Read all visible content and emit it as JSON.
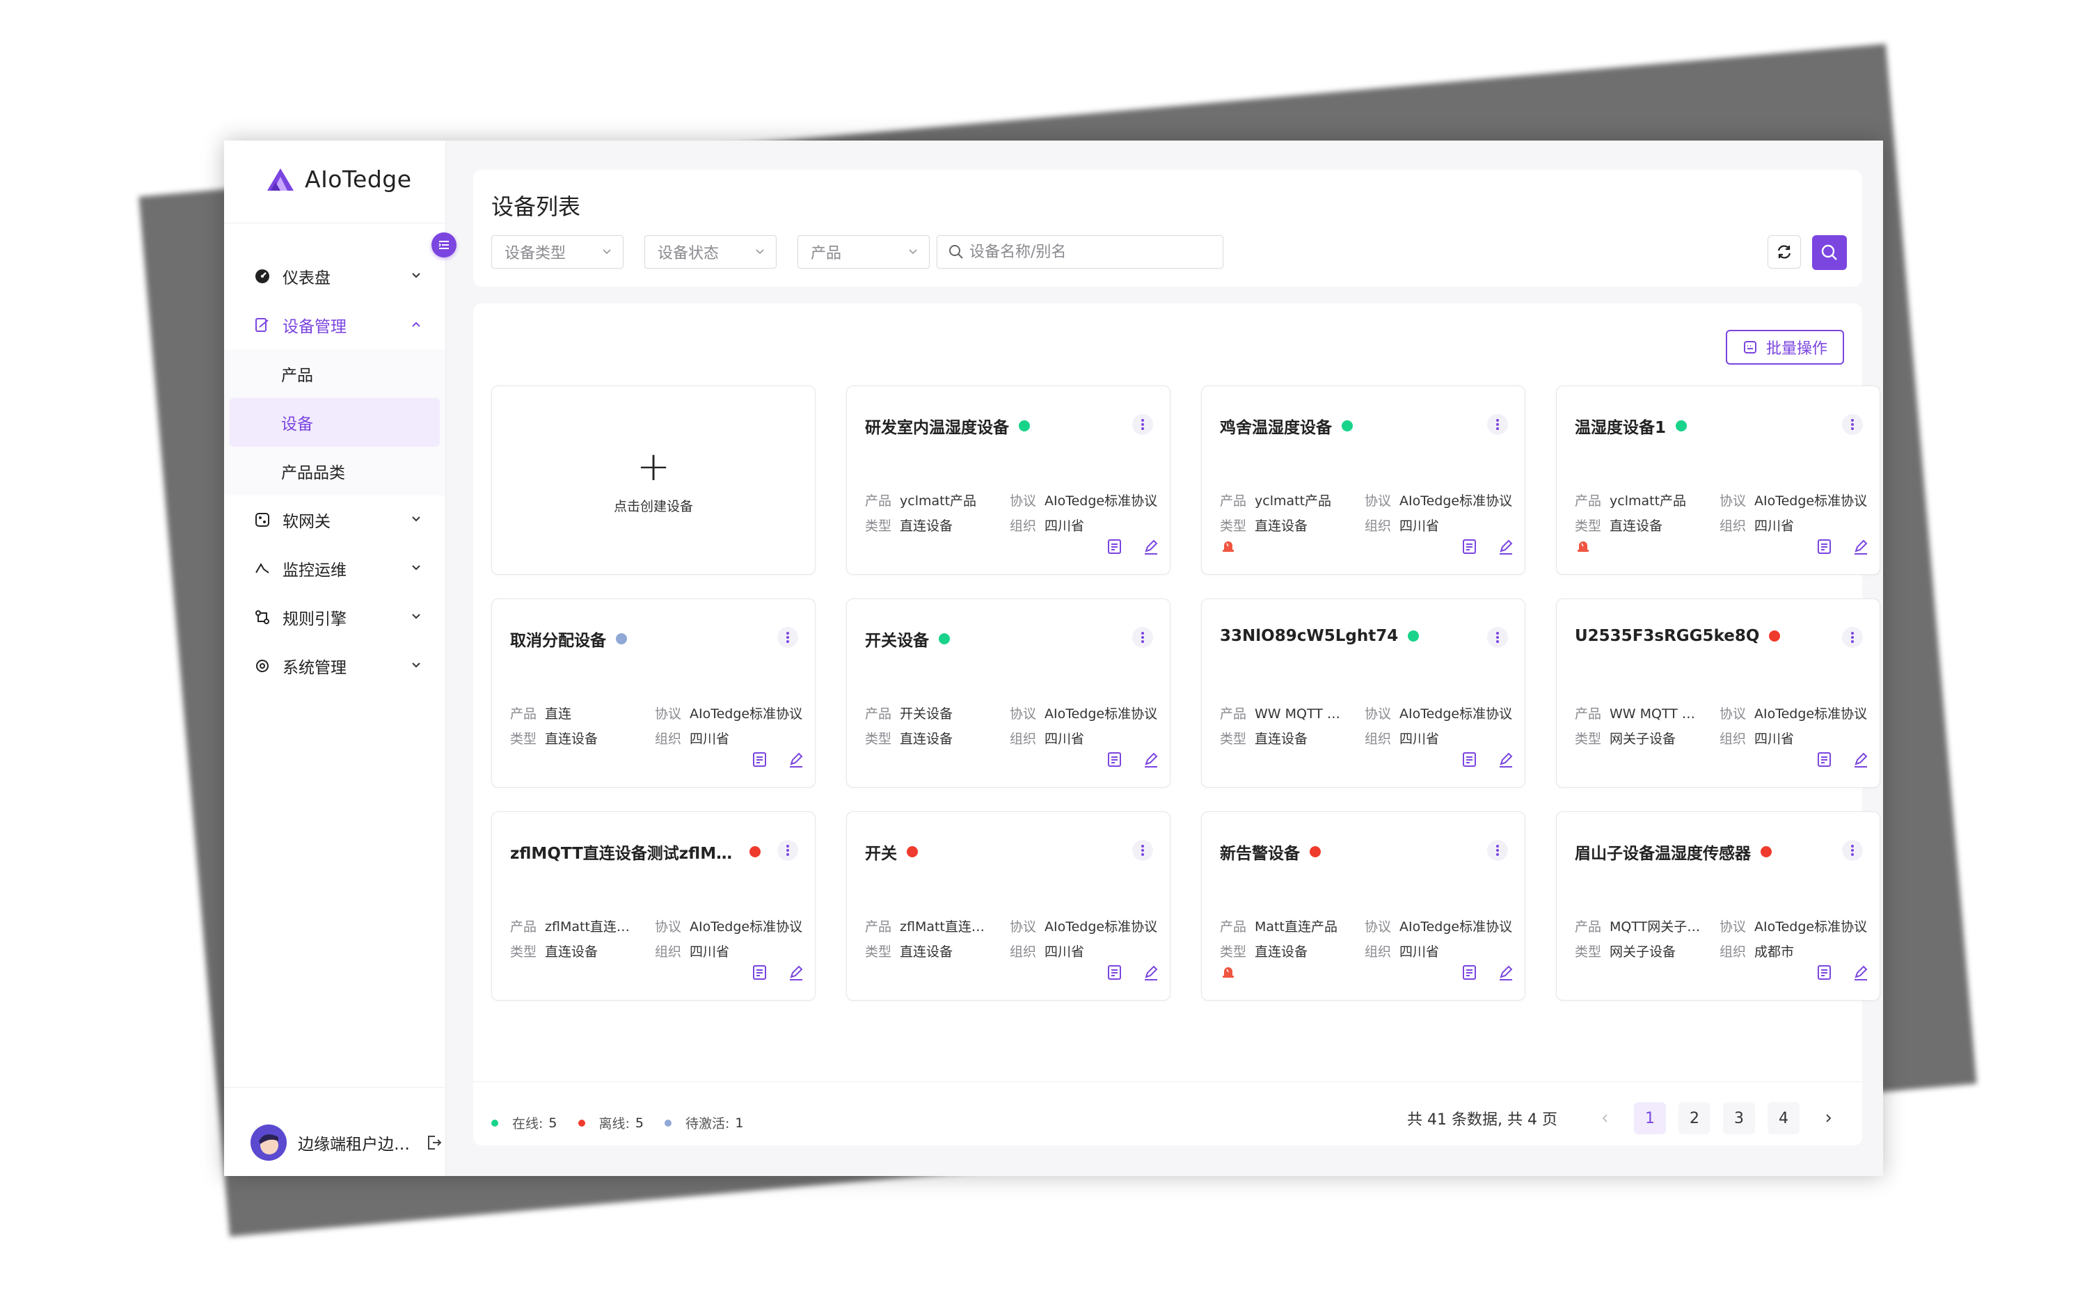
{
  "app": {
    "logo_text": "AIoTedge"
  },
  "sidebar": {
    "items": [
      {
        "label": "仪表盘",
        "icon": "dashboard-icon"
      },
      {
        "label": "设备管理",
        "icon": "device-manage-icon",
        "active": true,
        "children": [
          {
            "label": "产品"
          },
          {
            "label": "设备",
            "selected": true
          },
          {
            "label": "产品品类"
          }
        ]
      },
      {
        "label": "软网关",
        "icon": "gateway-icon"
      },
      {
        "label": "监控运维",
        "icon": "monitor-icon"
      },
      {
        "label": "规则引擎",
        "icon": "rule-icon"
      },
      {
        "label": "系统管理",
        "icon": "settings-icon"
      }
    ],
    "user": {
      "name": "边缘端租户边…"
    }
  },
  "header": {
    "title": "设备列表",
    "filters": {
      "device_type": "设备类型",
      "device_status": "设备状态",
      "product": "产品"
    },
    "search_placeholder": "设备名称/别名"
  },
  "list": {
    "batch_label": "批量操作",
    "create_label": "点击创建设备",
    "field_labels": {
      "product": "产品",
      "protocol": "协议",
      "type": "类型",
      "org": "组织"
    },
    "devices": [
      {
        "name": "研发室内温湿度设备",
        "status": "online",
        "product": "yclmatt产品",
        "protocol": "AIoTedge标准协议",
        "type": "直连设备",
        "org": "四川省",
        "alarm": false
      },
      {
        "name": "鸡舍温湿度设备",
        "status": "online",
        "product": "yclmatt产品",
        "protocol": "AIoTedge标准协议",
        "type": "直连设备",
        "org": "四川省",
        "alarm": true
      },
      {
        "name": "温湿度设备1",
        "status": "online",
        "product": "yclmatt产品",
        "protocol": "AIoTedge标准协议",
        "type": "直连设备",
        "org": "四川省",
        "alarm": true
      },
      {
        "name": "取消分配设备",
        "status": "pending",
        "product": "直连",
        "protocol": "AIoTedge标准协议",
        "type": "直连设备",
        "org": "四川省",
        "alarm": false
      },
      {
        "name": "开关设备",
        "status": "online",
        "product": "开关设备",
        "protocol": "AIoTedge标准协议",
        "type": "直连设备",
        "org": "四川省",
        "alarm": false
      },
      {
        "name": "33NlO89cW5Lght74",
        "status": "online",
        "product": "WW MQTT 直连…",
        "protocol": "AIoTedge标准协议",
        "type": "直连设备",
        "org": "四川省",
        "alarm": false
      },
      {
        "name": "U2535F3sRGG5ke8Q",
        "status": "offline",
        "product": "WW MQTT 网关…",
        "protocol": "AIoTedge标准协议",
        "type": "网关子设备",
        "org": "四川省",
        "alarm": false
      },
      {
        "name": "zflMQTT直连设备测试zflMQT…",
        "status": "offline",
        "product": "zflMatt直连产品",
        "protocol": "AIoTedge标准协议",
        "type": "直连设备",
        "org": "四川省",
        "alarm": false
      },
      {
        "name": "开关",
        "status": "offline",
        "product": "zflMatt直连产品",
        "protocol": "AIoTedge标准协议",
        "type": "直连设备",
        "org": "四川省",
        "alarm": false
      },
      {
        "name": "新告警设备",
        "status": "offline",
        "product": "Matt直连产品",
        "protocol": "AIoTedge标准协议",
        "type": "直连设备",
        "org": "四川省",
        "alarm": true
      },
      {
        "name": "眉山子设备温湿度传感器",
        "status": "offline",
        "product": "MQTT网关子产品",
        "protocol": "AIoTedge标准协议",
        "type": "网关子设备",
        "org": "成都市",
        "alarm": false
      }
    ]
  },
  "status_colors": {
    "online": "#19d38a",
    "offline": "#ef3b2d",
    "pending": "#8fa8d6"
  },
  "legend": {
    "online_label": "在线:",
    "online_count": "5",
    "offline_label": "离线:",
    "offline_count": "5",
    "pending_label": "待激活:",
    "pending_count": "1"
  },
  "pagination": {
    "total_text": "共 41 条数据, 共 4 页",
    "pages": [
      "1",
      "2",
      "3",
      "4"
    ],
    "current": "1"
  }
}
